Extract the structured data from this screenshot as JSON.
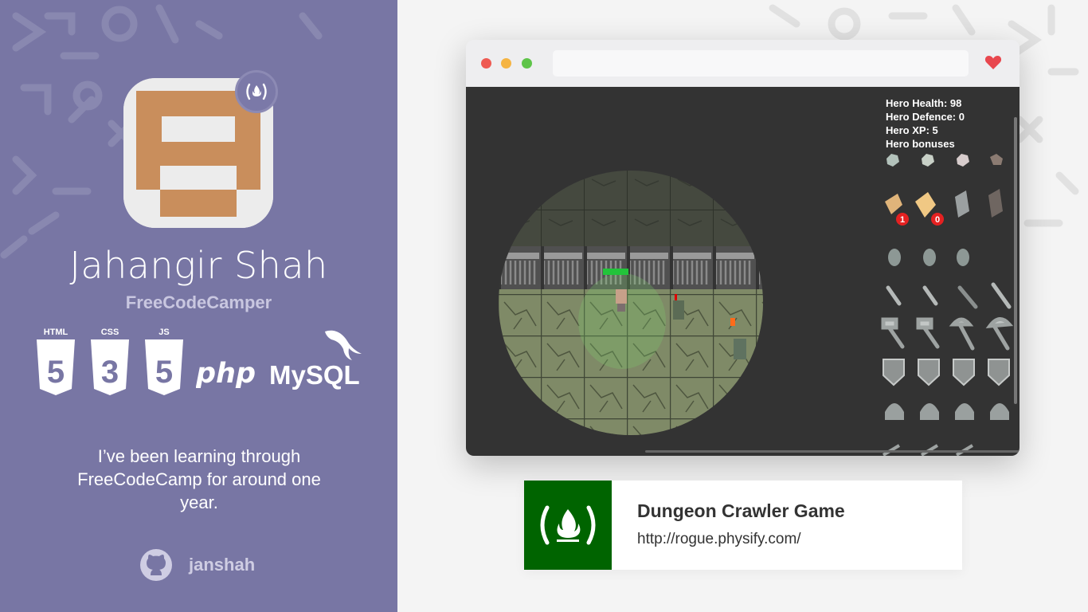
{
  "profile": {
    "name": "Jahangir Shah",
    "subtitle": "FreeCodeCamper",
    "bio": "I’ve been learning through FreeCodeCamp for around one year.",
    "github_username": "janshah"
  },
  "tech_stack": [
    {
      "label": "HTML",
      "number": "5",
      "icon": "html5-icon"
    },
    {
      "label": "CSS",
      "number": "3",
      "icon": "css3-icon"
    },
    {
      "label": "JS",
      "number": "5",
      "icon": "js-icon"
    },
    {
      "label": "php",
      "icon": "php-logo"
    },
    {
      "label": "MySQL",
      "icon": "mysql-logo"
    }
  ],
  "browser": {
    "url": "",
    "traffic_lights": [
      "#ee5a52",
      "#f5b443",
      "#5ec449"
    ]
  },
  "game": {
    "stats": [
      "Hero Health: 98",
      "Hero Defence: 0",
      "Hero XP: 5",
      "Hero bonuses"
    ],
    "badges": [
      "1",
      "0"
    ]
  },
  "project": {
    "title": "Dungeon Crawler Game",
    "url": "http://rogue.physify.com/"
  },
  "colors": {
    "panel": "#7876a4",
    "accent_green": "#006400",
    "avatar_tan": "#c98e5c",
    "heart": "#e8474e"
  }
}
